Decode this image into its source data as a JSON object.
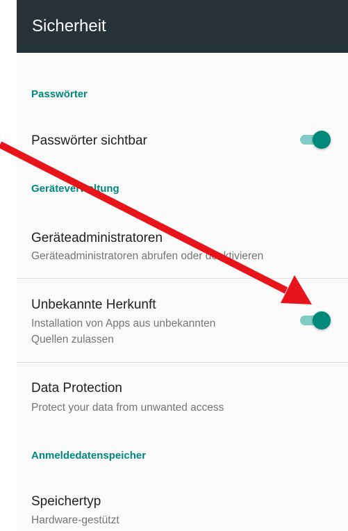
{
  "appbar": {
    "title": "Sicherheit"
  },
  "sections": {
    "passwords": {
      "header": "Passwörter",
      "visible_passwords": {
        "title": "Passwörter sichtbar",
        "switch_on": true
      }
    },
    "device_admin": {
      "header": "Geräteverwaltung",
      "administrators": {
        "title": "Geräteadministratoren",
        "summary": "Geräteadministratoren abrufen oder deaktivieren"
      },
      "unknown_sources": {
        "title": "Unbekannte Herkunft",
        "summary_line1": "Installation von Apps aus unbekannten",
        "summary_line2": "Quellen zulassen",
        "switch_on": true
      },
      "data_protection": {
        "title": "Data Protection",
        "summary": "Protect your data from unwanted access"
      }
    },
    "credential_storage": {
      "header": "Anmeldedatenspeicher",
      "storage_type": {
        "title": "Speichertyp",
        "summary": "Hardware-gestützt"
      }
    }
  },
  "colors": {
    "appbar": "#263238",
    "accent": "#00897b",
    "switch_track": "#80cbc4",
    "annotation_arrow": "#e8141b"
  }
}
